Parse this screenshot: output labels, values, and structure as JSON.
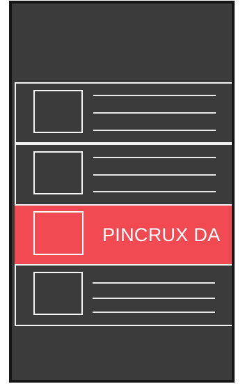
{
  "colors": {
    "device_background": "#3b3b3b",
    "device_frame": "#161616",
    "card_border": "#f2f2f2",
    "ad_background": "#f14a52",
    "ad_text": "#ffffff"
  },
  "feed": {
    "items": [
      {
        "kind": "placeholder-card",
        "thumbnail": "image-placeholder"
      },
      {
        "kind": "placeholder-card",
        "thumbnail": "image-placeholder"
      },
      {
        "kind": "ad-banner",
        "thumbnail": "image-placeholder"
      },
      {
        "kind": "placeholder-card",
        "thumbnail": "image-placeholder"
      }
    ]
  },
  "ad": {
    "label": "PINCRUX DA"
  }
}
